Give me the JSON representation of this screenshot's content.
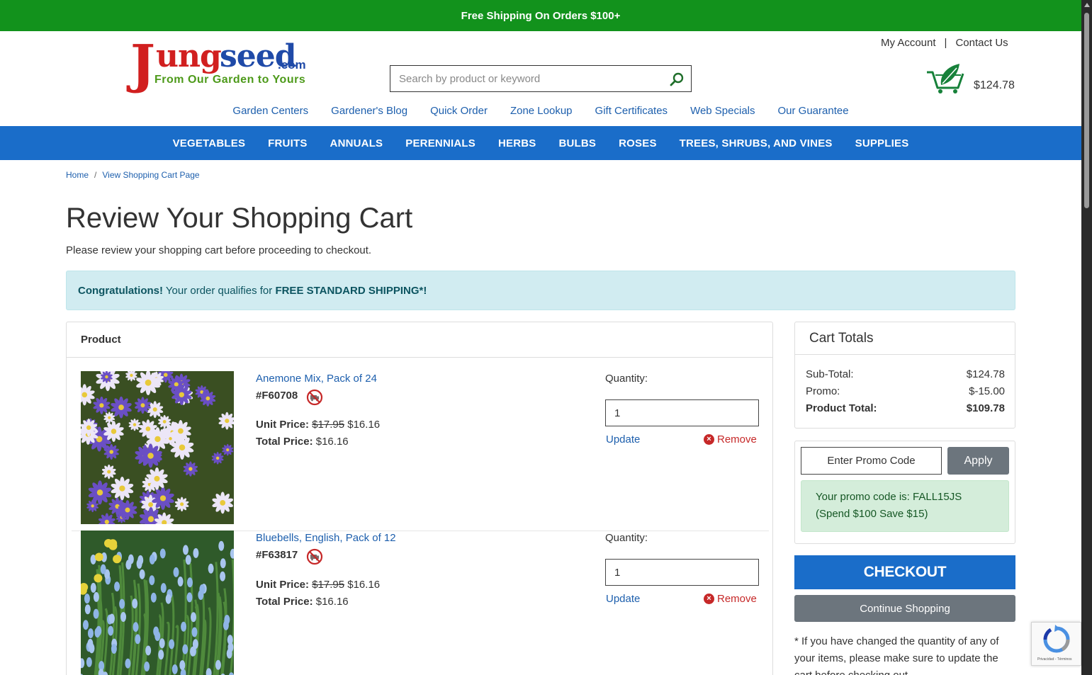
{
  "promo_bar": {
    "text": "Free Shipping On Orders $100+"
  },
  "logo": {
    "j": "J",
    "ung": "ung",
    "seed": "seed",
    "com": ".com",
    "tagline": "From Our Garden to Yours"
  },
  "search": {
    "placeholder": "Search by product or keyword"
  },
  "account": {
    "my_account": "My Account",
    "separator": "|",
    "contact_us": "Contact Us"
  },
  "cart": {
    "total": "$124.78"
  },
  "subnav": [
    "Garden Centers",
    "Gardener's Blog",
    "Quick Order",
    "Zone Lookup",
    "Gift Certificates",
    "Web Specials",
    "Our Guarantee"
  ],
  "mainnav": [
    "VEGETABLES",
    "FRUITS",
    "ANNUALS",
    "PERENNIALS",
    "HERBS",
    "BULBS",
    "ROSES",
    "TREES, SHRUBS, AND VINES",
    "SUPPLIES"
  ],
  "breadcrumb": {
    "home": "Home",
    "sep": "/",
    "current": "View Shopping Cart Page"
  },
  "page": {
    "title": "Review Your Shopping Cart",
    "description": "Please review your shopping cart before proceeding to checkout."
  },
  "alert": {
    "bold_lead": "Congratulations!",
    "text": " Your order qualifies for ",
    "bold_tail": "FREE STANDARD SHIPPING*!"
  },
  "products_panel": {
    "header": "Product",
    "items": [
      {
        "name": "Anemone Mix, Pack of 24",
        "sku": "#F60708",
        "unit_label": "Unit Price:",
        "old_price": "$17.95",
        "unit_price": "$16.16",
        "total_label": "Total Price:",
        "total_price": "$16.16",
        "qty_label": "Quantity:",
        "qty": "1",
        "update": "Update",
        "remove": "Remove"
      },
      {
        "name": "Bluebells, English, Pack of 12",
        "sku": "#F63817",
        "unit_label": "Unit Price:",
        "old_price": "$17.95",
        "unit_price": "$16.16",
        "total_label": "Total Price:",
        "total_price": "$16.16",
        "qty_label": "Quantity:",
        "qty": "1",
        "update": "Update",
        "remove": "Remove"
      }
    ]
  },
  "totals": {
    "header": "Cart Totals",
    "subtotal_label": "Sub-Total:",
    "subtotal": "$124.78",
    "promo_label": "Promo:",
    "promo": "$-15.00",
    "product_total_label": "Product Total:",
    "product_total": "$109.78"
  },
  "promo": {
    "placeholder": "Enter Promo Code",
    "apply": "Apply",
    "message_line1": "Your promo code is: FALL15JS",
    "message_line2": "(Spend $100 Save $15)"
  },
  "checkout": {
    "label": "CHECKOUT"
  },
  "continue": {
    "label": "Continue Shopping"
  },
  "note": {
    "text": "* If you have changed the quantity of any of your items, please make sure to update the cart before checking out."
  },
  "recaptcha": {
    "text": "Privacidad - Términos"
  },
  "colors": {
    "promo_green": "#12921c",
    "nav_blue": "#1a6dc9",
    "link_blue": "#1d5fad",
    "remove_red": "#c62828"
  }
}
